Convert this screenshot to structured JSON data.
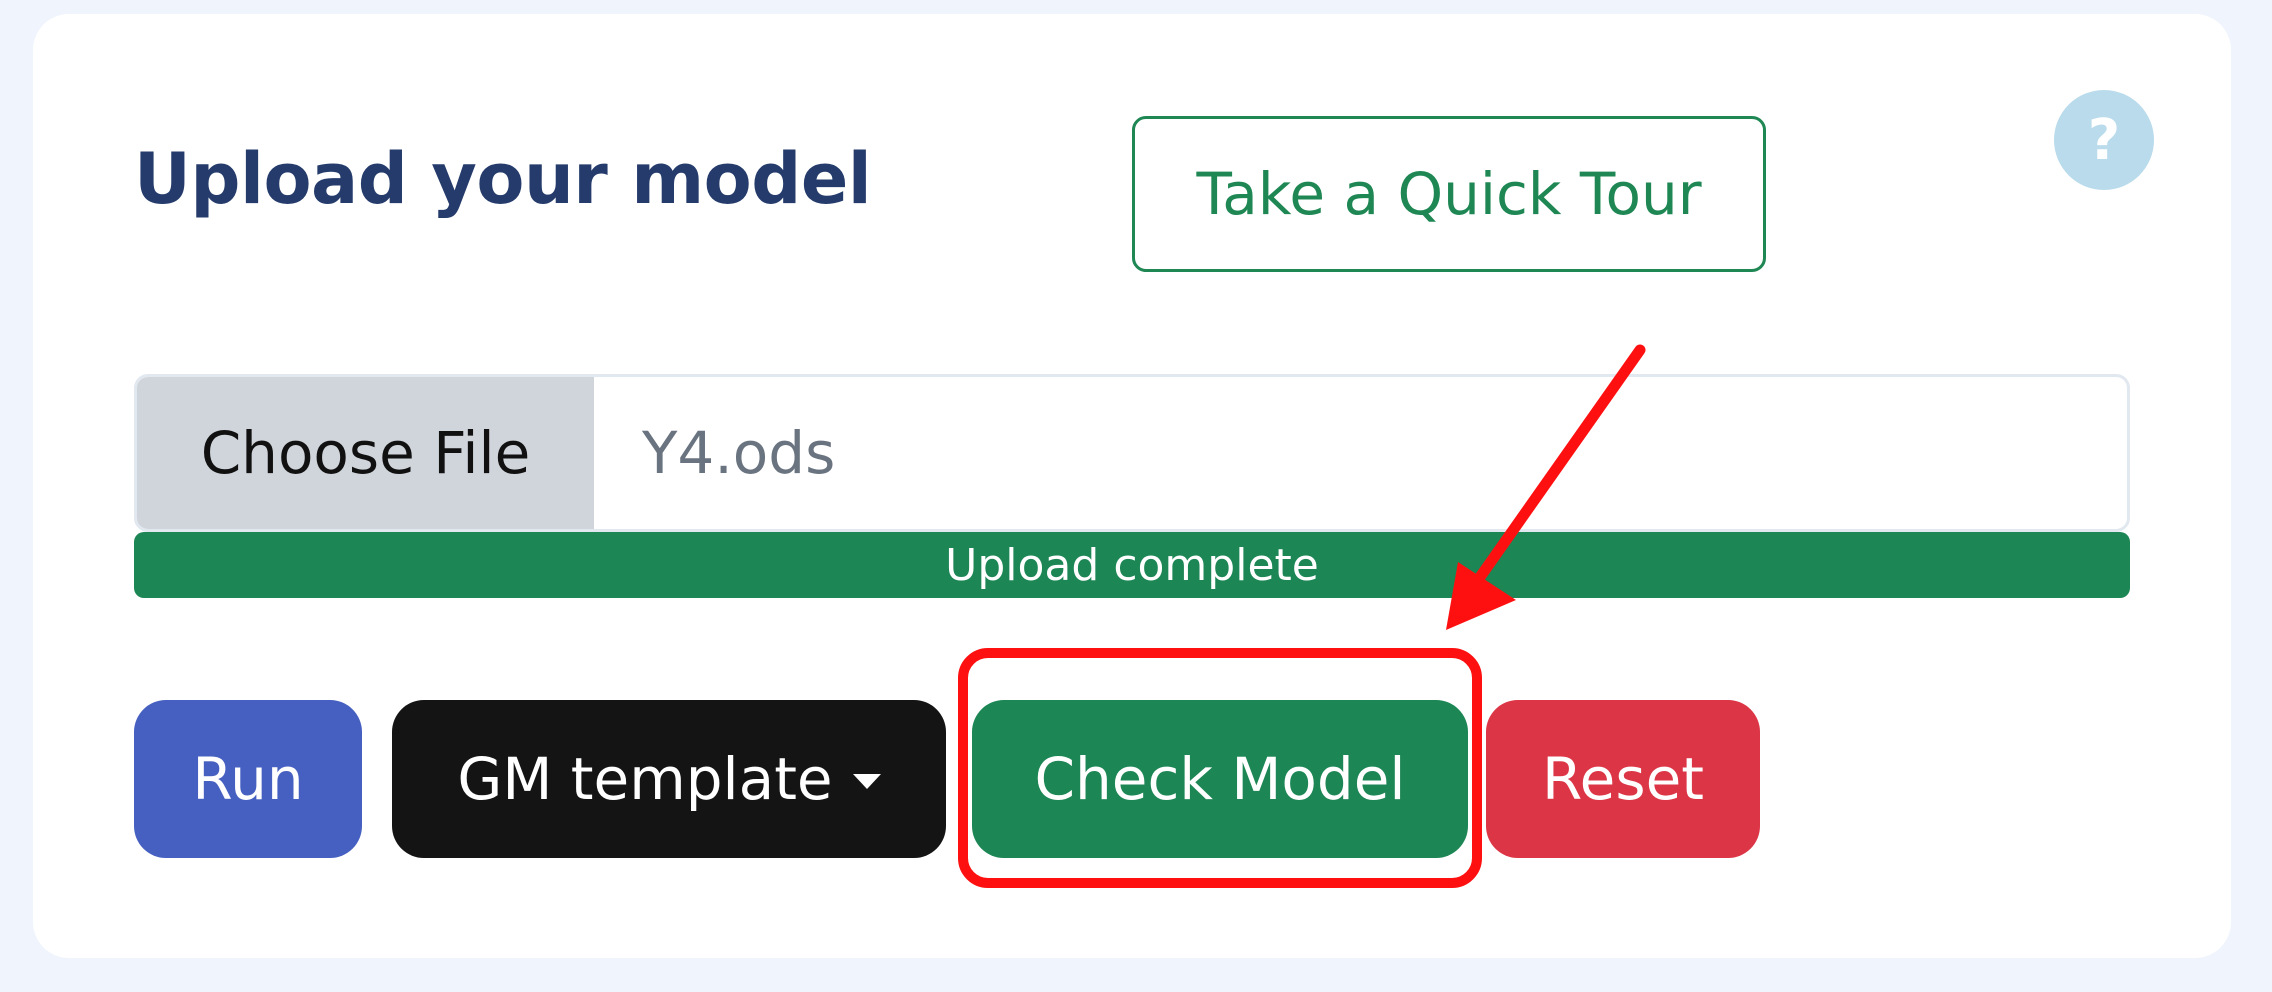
{
  "header": {
    "title": "Upload your model",
    "tour_button_label": "Take a Quick Tour",
    "help_icon_glyph": "?"
  },
  "upload": {
    "choose_file_label": "Choose File",
    "file_name": "Y4.ods",
    "progress_label": "Upload complete",
    "progress_fraction": 1.0
  },
  "actions": {
    "run_label": "Run",
    "template_label": "GM template",
    "check_model_label": "Check Model",
    "reset_label": "Reset"
  },
  "colors": {
    "title": "#243b6b",
    "green": "#1c8655",
    "run_blue": "#4660c1",
    "reset_red": "#dc3546",
    "annotation_red": "#ff1010"
  },
  "icons": {
    "help": "question-mark-icon",
    "dropdown": "caret-down-icon",
    "annotation": "red-arrow-annotation"
  }
}
